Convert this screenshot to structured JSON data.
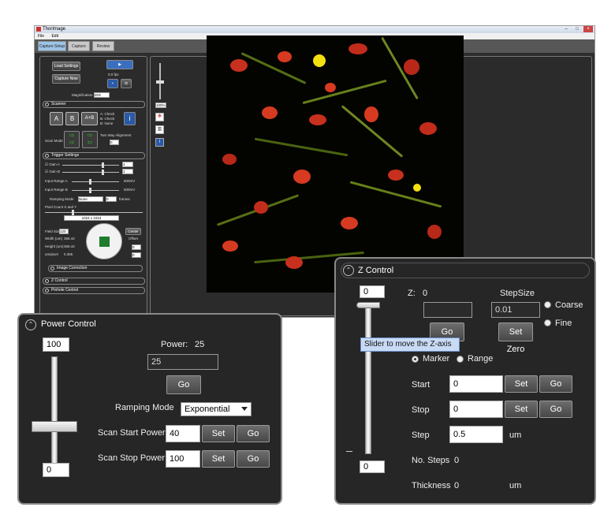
{
  "app": {
    "title": "ThorImage",
    "menu": [
      "File",
      "Edit"
    ],
    "tabs": [
      "Capture Setup",
      "Capture",
      "Review"
    ]
  },
  "left": {
    "load_settings": "Load Settings",
    "capture_now": "Capture Now",
    "fps": "0.0 fps",
    "magnification_label": "Magnification",
    "magnification_value": "20X",
    "scanner": "Scanner",
    "channels": [
      "A",
      "B",
      "A+B"
    ],
    "channel_checks": [
      "A: Check",
      "B: Check",
      "B: None"
    ],
    "scan_mode": "Scan Mode",
    "two_way": "Two Way Alignment",
    "two_way_value": "0",
    "trigger": "Trigger Settings",
    "gain_a": "Gain A",
    "gain_b": "Gain B",
    "gain_a_value": "1",
    "gain_b_value": "1",
    "input_range_a": "Input Range A",
    "input_range_b": "Input Range B",
    "input_range_a_value": "500mV",
    "input_range_b_value": "500mV",
    "ramping_mode": "Ramping Mode",
    "ramping_value": "None",
    "frames_value": "0",
    "frames": "frames",
    "pixel_count": "Pixel Count X and Y",
    "pixel_value": "1024 x 1024",
    "field_size": "Field Size",
    "field_value": "120",
    "width_um": "Width (um)",
    "width_value": "368.42",
    "height_um": "Height (um)",
    "height_value": "368.42",
    "um_pixel": "um/pixel",
    "um_pixel_value": "0.355",
    "center": "Center",
    "offset": "Offset",
    "offset_x": "0",
    "offset_y": "0",
    "image_correction": "Image Correction",
    "z_control": "Z Control",
    "pinhole": "Pinhole Control"
  },
  "viewer": {
    "zoom": "100%"
  },
  "power": {
    "title": "Power Control",
    "slider_top": "100",
    "slider_bottom": "0",
    "power_label": "Power:",
    "power_value": "25",
    "power_input": "25",
    "go": "Go",
    "ramping_label": "Ramping Mode",
    "ramping_value": "Exponential",
    "start_label": "Scan Start Power",
    "start_value": "40",
    "stop_label": "Scan Stop Power",
    "stop_value": "100",
    "set": "Set",
    "slider_level": 0.25
  },
  "zcontrol": {
    "title": "Z Control",
    "slider_top": "0",
    "slider_bottom": "0",
    "z_label": "Z:",
    "z_value": "0",
    "stepsize_label": "StepSize",
    "stepsize_value": "0.01",
    "coarse": "Coarse",
    "fine": "Fine",
    "go": "Go",
    "set_zero": "Set Zero",
    "tooltip": "Slider to move the Z-axis",
    "marker": "Marker",
    "range": "Range",
    "start_label": "Start",
    "start_value": "0",
    "stop_label": "Stop",
    "stop_value": "0",
    "set": "Set",
    "step_label": "Step",
    "step_value": "0.5",
    "um": "um",
    "no_steps_label": "No. Steps",
    "no_steps_value": "0",
    "thickness_label": "Thickness",
    "thickness_value": "0",
    "thickness_um": "um"
  }
}
